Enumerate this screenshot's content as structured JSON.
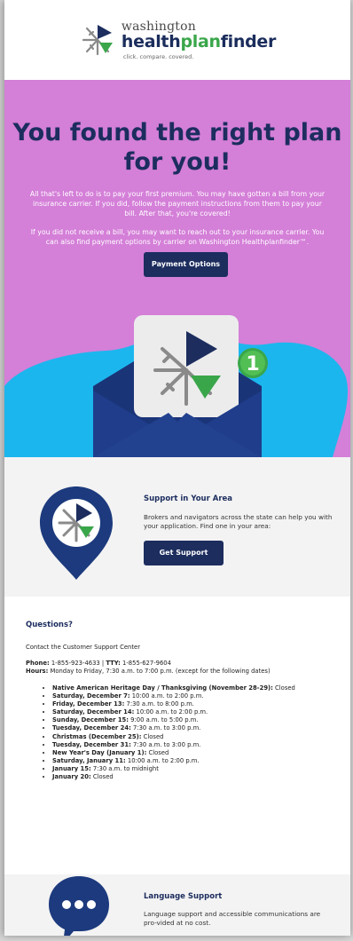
{
  "logo": {
    "line1": "washington",
    "line2_part1": "health",
    "line2_part2": "plan",
    "line2_part3": "finder",
    "tagline": "click. compare. covered."
  },
  "hero": {
    "title_line1": "You found the right plan",
    "title_line2": "for you!",
    "paragraph1": "All that's left to do is to pay your first premium. You may have gotten a bill from your insurance carrier. If you did, follow the payment instructions from them to pay your bill. After that, you're covered!",
    "paragraph2": "If you did not receive a bill, you may want to reach out to your insurance carrier. You can also find payment options by carrier on Washington Healthplanfinder™.",
    "button_label": "Payment Options",
    "badge_number": "1",
    "bg_color": "#d47fd8"
  },
  "support": {
    "title": "Support in Your Area",
    "body": "Brokers and navigators across the state can help you with your application. Find one in your area:",
    "button_label": "Get Support"
  },
  "questions": {
    "title": "Questions?",
    "lead": "Contact the Customer Support Center",
    "phone_label": "Phone:",
    "phone_value": " 1-855-923-4633 | ",
    "tty_label": "TTY:",
    "tty_value": " 1-855-627-9604",
    "hours_label": "Hours:",
    "hours_value": " Monday to Friday, 7:30 a.m. to 7:00 p.m. (except for the following dates)",
    "dates": [
      {
        "day": "Native American Heritage Day / Thanksgiving (November 28-29):",
        "hours": " Closed"
      },
      {
        "day": "Saturday, December 7:",
        "hours": " 10:00 a.m. to 2:00 p.m."
      },
      {
        "day": "Friday, December 13:",
        "hours": " 7:30 a.m. to 8:00 p.m."
      },
      {
        "day": "Saturday, December 14:",
        "hours": " 10:00 a.m. to 2:00 p.m."
      },
      {
        "day": "Sunday, December 15:",
        "hours": " 9:00 a.m. to 5:00 p.m."
      },
      {
        "day": "Tuesday, December 24:",
        "hours": " 7:30 a.m. to 3:00 p.m."
      },
      {
        "day": "Christmas (December 25):",
        "hours": " Closed"
      },
      {
        "day": "Tuesday, December 31:",
        "hours": " 7:30 a.m. to 3:00 p.m."
      },
      {
        "day": "New Year's Day (January 1):",
        "hours": " Closed"
      },
      {
        "day": "Saturday, January 11:",
        "hours": " 10:00 a.m. to 2:00 p.m."
      },
      {
        "day": "January 15:",
        "hours": " 7:30 a.m. to midnight"
      },
      {
        "day": "January 20:",
        "hours": " Closed"
      }
    ]
  },
  "language": {
    "title": "Language Support",
    "body": "Language support and accessible communications are pro-vided at no cost."
  },
  "colors": {
    "navy": "#1c2d5e",
    "green": "#3aa64a",
    "cyan": "#1cb6ee",
    "purple": "#d47fd8"
  }
}
